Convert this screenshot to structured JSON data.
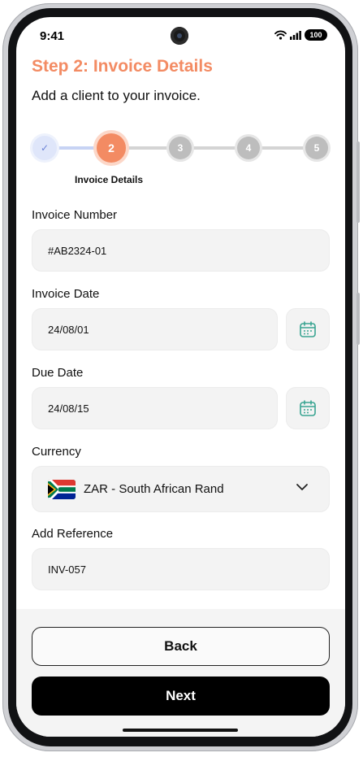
{
  "status_bar": {
    "time": "9:41",
    "battery": "100"
  },
  "header": {
    "title": "Step 2: Invoice Details",
    "subtitle": "Add a client to your invoice."
  },
  "stepper": {
    "current_step": 2,
    "steps": [
      {
        "label": "✓",
        "state": "done"
      },
      {
        "label": "2",
        "state": "active"
      },
      {
        "label": "3",
        "state": "pending"
      },
      {
        "label": "4",
        "state": "pending"
      },
      {
        "label": "5",
        "state": "pending"
      }
    ],
    "active_label": "Invoice Details"
  },
  "form": {
    "invoice_number": {
      "label": "Invoice Number",
      "value": "#AB2324-01"
    },
    "invoice_date": {
      "label": "Invoice Date",
      "value": "24/08/01",
      "icon": "calendar-icon"
    },
    "due_date": {
      "label": "Due Date",
      "value": "24/08/15",
      "icon": "calendar-icon"
    },
    "currency": {
      "label": "Currency",
      "value": "ZAR - South African Rand",
      "flag": "south-africa-flag"
    },
    "reference": {
      "label": "Add Reference",
      "value": "INV-057"
    }
  },
  "actions": {
    "back_label": "Back",
    "next_label": "Next"
  },
  "colors": {
    "accent": "#f38b63",
    "done_step": "#dfe6fa",
    "done_check": "#6b82d6",
    "pending_step": "#bdbdbd",
    "calendar_icon": "#3aa592",
    "primary_button": "#000000"
  }
}
